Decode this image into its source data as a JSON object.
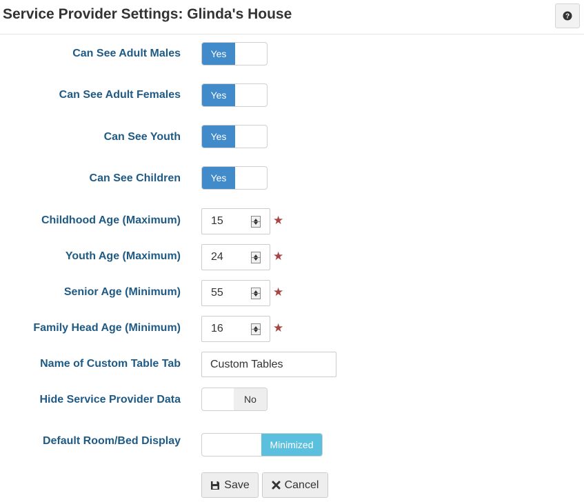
{
  "header": {
    "title": "Service Provider Settings: Glinda's House",
    "help_icon": "question-circle-icon"
  },
  "toggles": [
    {
      "label": "Can See Adult Males",
      "on_label": "Yes",
      "value": true
    },
    {
      "label": "Can See Adult Females",
      "on_label": "Yes",
      "value": true
    },
    {
      "label": "Can See Youth",
      "on_label": "Yes",
      "value": true
    },
    {
      "label": "Can See Children",
      "on_label": "Yes",
      "value": true
    }
  ],
  "ages": [
    {
      "label": "Childhood Age (Maximum)",
      "value": "15",
      "required": true
    },
    {
      "label": "Youth Age (Maximum)",
      "value": "24",
      "required": true
    },
    {
      "label": "Senior Age (Minimum)",
      "value": "55",
      "required": true
    },
    {
      "label": "Family Head Age (Minimum)",
      "value": "16",
      "required": true
    }
  ],
  "required_marker": "★",
  "custom_tab": {
    "label": "Name of Custom Table Tab",
    "value": "Custom Tables"
  },
  "hide_data": {
    "label": "Hide Service Provider Data",
    "off_label": "No",
    "value": false
  },
  "room_display": {
    "label": "Default Room/Bed Display",
    "value": "Minimized"
  },
  "buttons": {
    "save_label": "Save",
    "save_icon": "floppy-disk-icon",
    "cancel_label": "Cancel",
    "cancel_icon": "close-icon"
  },
  "colors": {
    "label": "#1f5a85",
    "toggle_on": "#428bca",
    "toggle_info": "#5bc0de",
    "required": "#a94442"
  }
}
